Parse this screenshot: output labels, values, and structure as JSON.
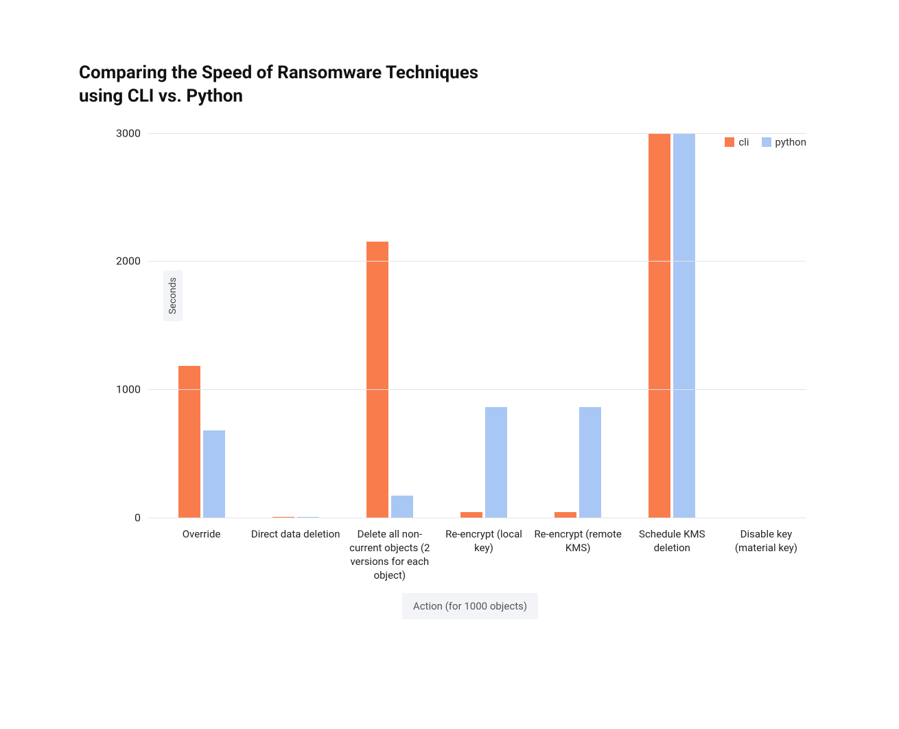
{
  "title": "Comparing the Speed of Ransomware Techniques using CLI vs. Python",
  "legend": {
    "series1": "cli",
    "series2": "python"
  },
  "colors": {
    "cli": "#f97d4c",
    "python": "#a9c7f4",
    "grid": "#e5e5e5",
    "axis_label_bg": "#f2f4f8"
  },
  "y_axis": {
    "label": "Seconds",
    "ticks": [
      0,
      1000,
      2000,
      3000
    ],
    "max": 3000
  },
  "x_axis": {
    "label": "Action (for 1000 objects)"
  },
  "chart_data": {
    "type": "bar",
    "title": "Comparing the Speed of Ransomware Techniques using CLI vs. Python",
    "xlabel": "Action (for 1000 objects)",
    "ylabel": "Seconds",
    "ylim": [
      0,
      3000
    ],
    "categories": [
      "Override",
      "Direct data deletion",
      "Delete all non-current objects (2 versions for each object)",
      "Re-encrypt (local key)",
      "Re-encrypt (remote KMS)",
      "Schedule KMS deletion",
      "Disable key (material key)"
    ],
    "series": [
      {
        "name": "cli",
        "color": "#f97d4c",
        "values": [
          1180,
          5,
          2150,
          40,
          40,
          3000,
          0
        ]
      },
      {
        "name": "python",
        "color": "#a9c7f4",
        "values": [
          680,
          5,
          170,
          860,
          860,
          3000,
          0
        ]
      }
    ]
  }
}
